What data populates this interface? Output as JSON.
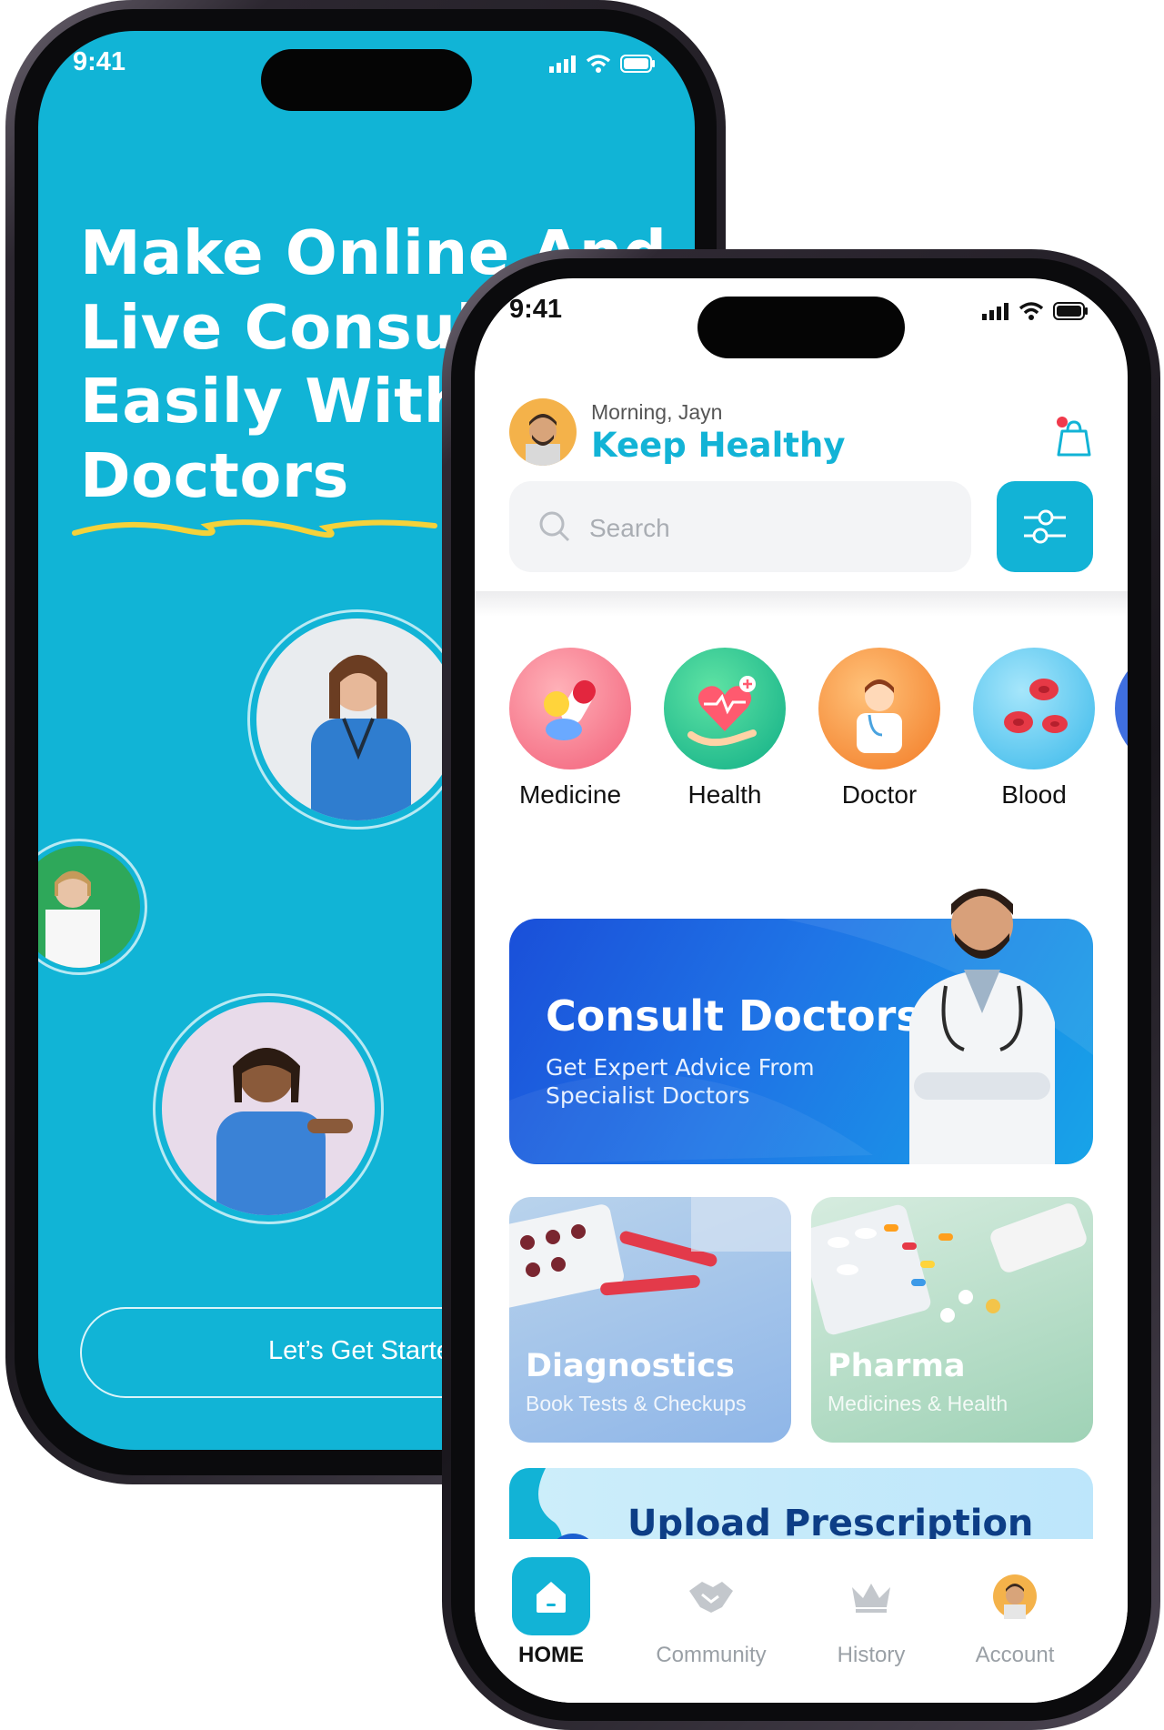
{
  "back_screen": {
    "status_time": "9:41",
    "headline": "Make Online And\nLive Consultation\nEasily With Top\nDoctors",
    "cta_label": "Let’s Get Started",
    "colors": {
      "background": "#11b4d6",
      "underline": "#f5d23a"
    }
  },
  "front_screen": {
    "status_time": "9:41",
    "greeting": {
      "subtitle": "Morning, Jayn",
      "title": "Keep Healthy"
    },
    "search": {
      "placeholder": "Search"
    },
    "categories": [
      {
        "label": "Medicine",
        "icon": "pills-icon"
      },
      {
        "label": "Health",
        "icon": "heart-hand-icon"
      },
      {
        "label": "Doctor",
        "icon": "doctor-icon"
      },
      {
        "label": "Blood",
        "icon": "blood-cells-icon"
      }
    ],
    "consult_banner": {
      "title": "Consult Doctors",
      "subtitle": "Get Expert Advice From Specialist Doctors"
    },
    "tiles": [
      {
        "title": "Diagnostics",
        "subtitle": "Book Tests & Checkups"
      },
      {
        "title": "Pharma",
        "subtitle": "Medicines & Health"
      }
    ],
    "upload_banner": {
      "title": "Upload Prescription"
    },
    "tabs": [
      {
        "label": "HOME",
        "icon": "home-icon",
        "active": true
      },
      {
        "label": "Community",
        "icon": "handshake-icon",
        "active": false
      },
      {
        "label": "History",
        "icon": "crown-icon",
        "active": false
      },
      {
        "label": "Account",
        "icon": "avatar-icon",
        "active": false
      }
    ],
    "colors": {
      "accent": "#12b3d6",
      "notification_dot": "#f0394b"
    }
  }
}
